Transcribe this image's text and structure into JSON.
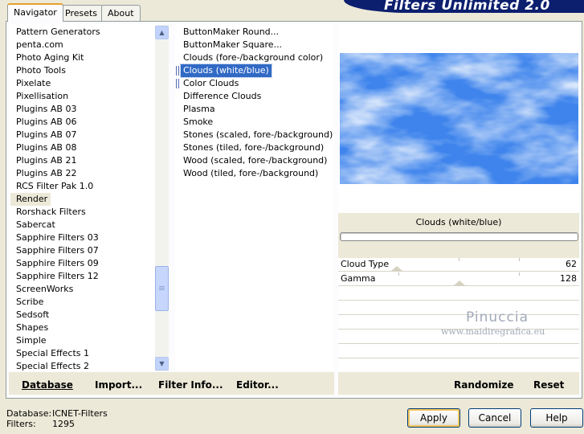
{
  "title": "Filters Unlimited 2.0",
  "tabs": [
    {
      "label": "Navigator",
      "active": true
    },
    {
      "label": "Presets",
      "active": false
    },
    {
      "label": "About",
      "active": false
    }
  ],
  "categories": [
    "Pattern Generators",
    "penta.com",
    "Photo Aging Kit",
    "Photo Tools",
    "Pixelate",
    "Pixellisation",
    "Plugins AB 03",
    "Plugins AB 06",
    "Plugins AB 07",
    "Plugins AB 08",
    "Plugins AB 21",
    "Plugins AB 22",
    "RCS Filter Pak 1.0",
    "Render",
    "Rorshack Filters",
    "Sabercat",
    "Sapphire Filters 03",
    "Sapphire Filters 07",
    "Sapphire Filters 09",
    "Sapphire Filters 12",
    "ScreenWorks",
    "Scribe",
    "Sedsoft",
    "Shapes",
    "Simple",
    "Special Effects 1",
    "Special Effects 2"
  ],
  "selected_category": "Render",
  "filters": [
    "ButtonMaker Round...",
    "ButtonMaker Square...",
    "Clouds (fore-/background color)",
    "Clouds (white/blue)",
    "Color Clouds",
    "Difference Clouds",
    "Plasma",
    "Smoke",
    "Stones (scaled, fore-/background)",
    "Stones (tiled, fore-/background)",
    "Wood (scaled, fore-/background)",
    "Wood (tiled, fore-/background)"
  ],
  "selected_filter": "Clouds (white/blue)",
  "current_filter_name": "Clouds (white/blue)",
  "params": [
    {
      "label": "Cloud Type",
      "value": "62"
    },
    {
      "label": "Gamma",
      "value": "128"
    }
  ],
  "watermark": {
    "line1": "Pinuccia",
    "line2": "www.maidiregrafica.eu"
  },
  "toolbar": {
    "database": "Database",
    "import": "Import...",
    "filter_info": "Filter Info...",
    "editor": "Editor...",
    "randomize": "Randomize",
    "reset": "Reset"
  },
  "status": {
    "database_label": "Database:",
    "database_value": "ICNET-Filters",
    "filters_label": "Filters:",
    "filters_value": "1295"
  },
  "buttons": {
    "apply": "Apply",
    "cancel": "Cancel",
    "help": "Help"
  },
  "colors": {
    "accent": "#316ac5",
    "banner": "#0c1f6e",
    "preview_sky": "#4f90ef"
  }
}
